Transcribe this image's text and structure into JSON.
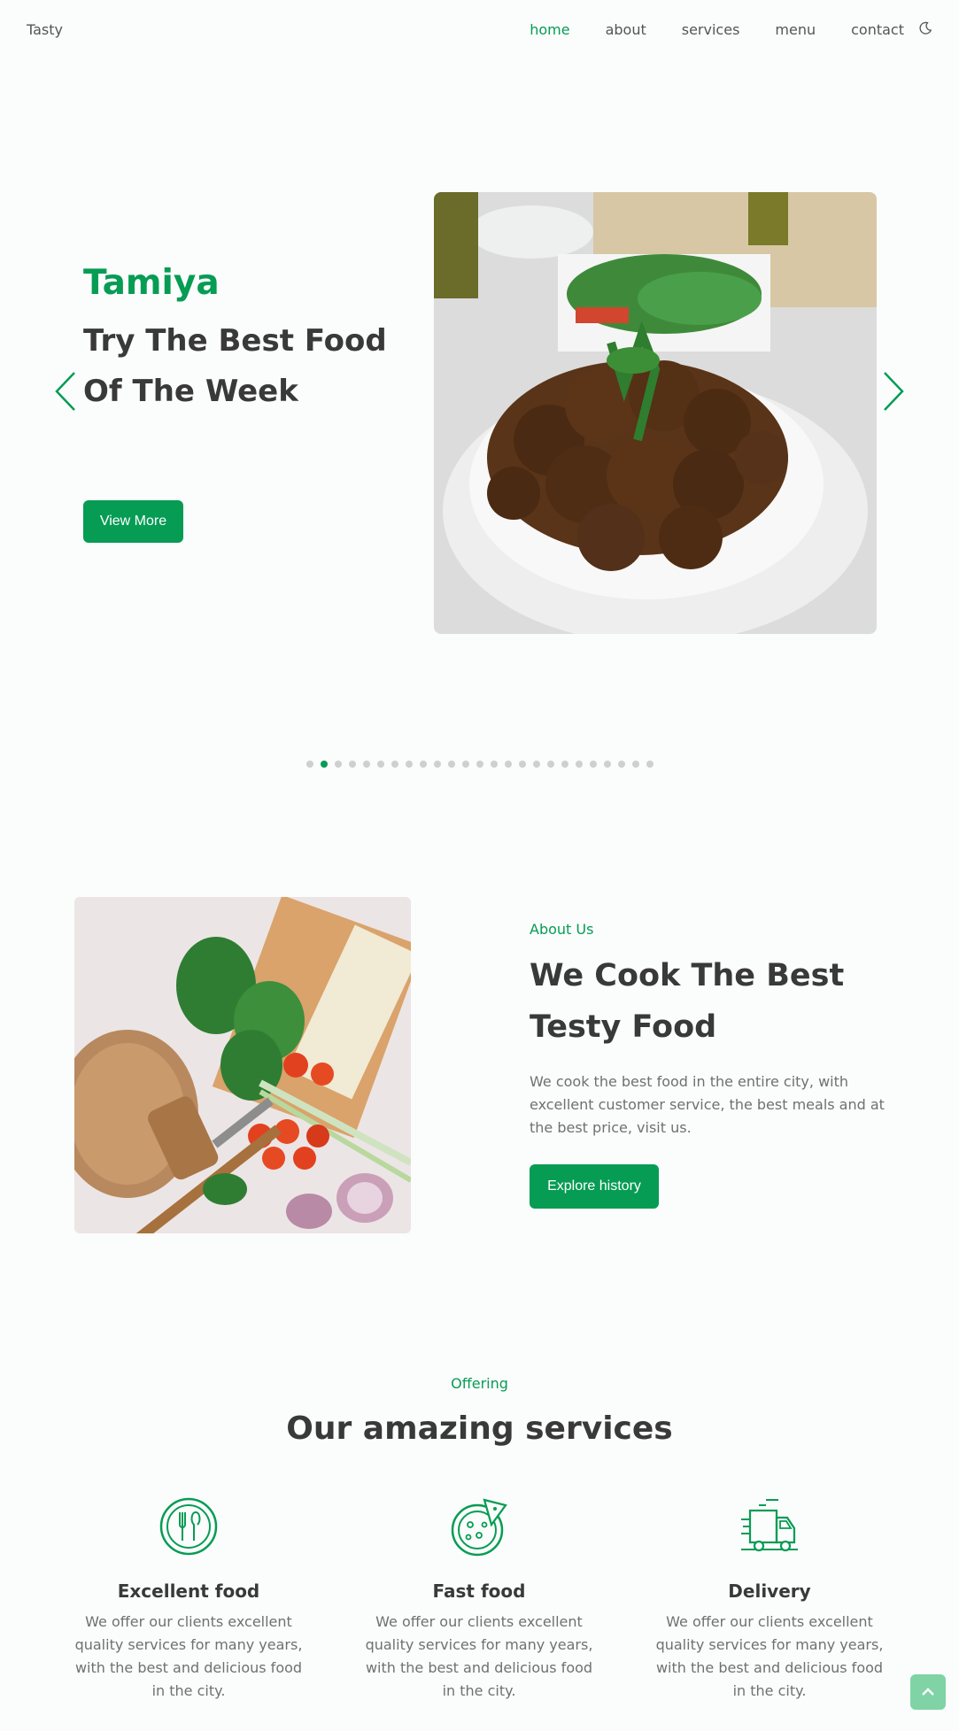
{
  "header": {
    "logo": "Tasty",
    "nav": [
      "home",
      "about",
      "services",
      "menu",
      "contact"
    ],
    "active_nav": "home",
    "theme_toggle_icon": "moon-icon"
  },
  "hero": {
    "subtitle": "Tamiya",
    "title": "Try The Best Food Of The Week",
    "button_label": "View More",
    "image": "falafel-plate",
    "slider": {
      "total_slides": 25,
      "active_index": 1
    }
  },
  "about": {
    "subtitle": "About Us",
    "title": "We Cook The Best Testy Food",
    "description": "We cook the best food in the entire city, with excellent customer service, the best meals and at the best price, visit us.",
    "button_label": "Explore history",
    "image": "bread-and-vegetables"
  },
  "services": {
    "subtitle": "Offering",
    "title": "Our amazing services",
    "items": [
      {
        "icon": "dining-icon",
        "title": "Excellent food",
        "description": "We offer our clients excellent quality services for many years, with the best and delicious food in the city."
      },
      {
        "icon": "pizza-icon",
        "title": "Fast food",
        "description": "We offer our clients excellent quality services for many years, with the best and delicious food in the city."
      },
      {
        "icon": "delivery-truck-icon",
        "title": "Delivery",
        "description": "We offer our clients excellent quality services for many years, with the best and delicious food in the city."
      }
    ]
  },
  "colors": {
    "accent": "#069c54",
    "text_dark": "#393939",
    "text_muted": "#707070",
    "scroll_top_bg": "#7fd3a5"
  }
}
